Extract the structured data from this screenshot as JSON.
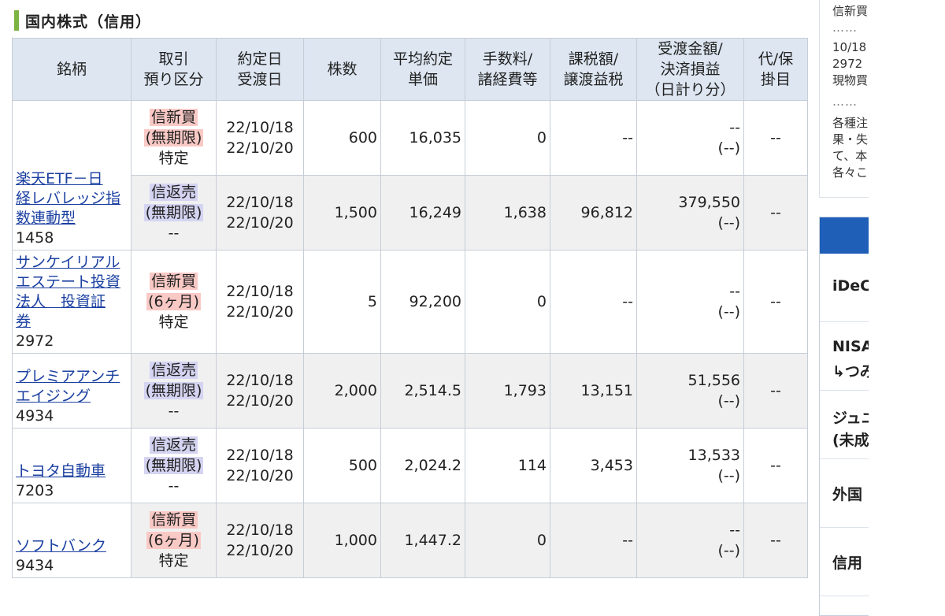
{
  "section_title": "国内株式（信用）",
  "columns": [
    [
      "銘柄"
    ],
    [
      "取引",
      "預り区分"
    ],
    [
      "約定日",
      "受渡日"
    ],
    [
      "株数"
    ],
    [
      "平均約定",
      "単価"
    ],
    [
      "手数料/",
      "諸経費等"
    ],
    [
      "課税額/",
      "譲渡益税"
    ],
    [
      "受渡金額/",
      "決済損益",
      "（日計り分）"
    ],
    [
      "代/保",
      "掛目"
    ]
  ],
  "rows": [
    {
      "name_lines": [
        "楽天ETF－日",
        "経レバレッジ指",
        "数連動型"
      ],
      "code": "1458",
      "trades": [
        {
          "type": "信新買",
          "type_kind": "buy",
          "period": "(無期限)",
          "custody": "特定",
          "date1": "22/10/18",
          "date2": "22/10/20",
          "shares": "600",
          "price": "16,035",
          "fee": "0",
          "tax": "--",
          "amount": "--",
          "pl": "(--)",
          "margin": "--"
        },
        {
          "type": "信返売",
          "type_kind": "sell",
          "period": "(無期限)",
          "custody": "--",
          "date1": "22/10/18",
          "date2": "22/10/20",
          "shares": "1,500",
          "price": "16,249",
          "fee": "1,638",
          "tax": "96,812",
          "amount": "379,550",
          "pl": "(--)",
          "margin": "--"
        }
      ]
    },
    {
      "name_lines": [
        "サンケイリアル",
        "エステート投資",
        "法人　投資証",
        "券"
      ],
      "code": "2972",
      "trades": [
        {
          "type": "信新買",
          "type_kind": "buy",
          "period": "(6ヶ月)",
          "custody": "特定",
          "date1": "22/10/18",
          "date2": "22/10/20",
          "shares": "5",
          "price": "92,200",
          "fee": "0",
          "tax": "--",
          "amount": "--",
          "pl": "(--)",
          "margin": "--"
        }
      ]
    },
    {
      "name_lines": [
        "プレミアアンチ",
        "エイジング"
      ],
      "code": "4934",
      "trades": [
        {
          "type": "信返売",
          "type_kind": "sell",
          "period": "(無期限)",
          "custody": "--",
          "date1": "22/10/18",
          "date2": "22/10/20",
          "shares": "2,000",
          "price": "2,514.5",
          "fee": "1,793",
          "tax": "13,151",
          "amount": "51,556",
          "pl": "(--)",
          "margin": "--"
        }
      ]
    },
    {
      "name_lines": [
        "トヨタ自動車"
      ],
      "code": "7203",
      "trades": [
        {
          "type": "信返売",
          "type_kind": "sell",
          "period": "(無期限)",
          "custody": "--",
          "date1": "22/10/18",
          "date2": "22/10/20",
          "shares": "500",
          "price": "2,024.2",
          "fee": "114",
          "tax": "3,453",
          "amount": "13,533",
          "pl": "(--)",
          "margin": "--"
        }
      ]
    },
    {
      "name_lines": [
        "ソフトバンク"
      ],
      "code": "9434",
      "trades": [
        {
          "type": "信新買",
          "type_kind": "buy",
          "period": "(6ヶ月)",
          "custody": "特定",
          "date1": "22/10/18",
          "date2": "22/10/20",
          "shares": "1,000",
          "price": "1,447.2",
          "fee": "0",
          "tax": "--",
          "amount": "--",
          "pl": "(--)",
          "margin": "--"
        }
      ]
    }
  ],
  "right_panel": {
    "lines": [
      "信新買",
      "……",
      "10/18",
      "2972",
      "現物買",
      "……",
      "各種注",
      "果・失",
      "て、本",
      "各々こ"
    ]
  },
  "side_menu": {
    "items": [
      {
        "label": "iDeCo"
      },
      {
        "label": "NISA",
        "sub": "つみ"
      },
      {
        "label": "ジュニ",
        "sub": "(未成"
      },
      {
        "label": "外国"
      },
      {
        "label": "信用"
      }
    ]
  },
  "colors": {
    "buy_label": "#f9c9c5",
    "sell_label": "#d4d4f2",
    "header_bg": "#dde6f1",
    "accent_bar": "#7cb342",
    "menu_head": "#1f5fb8"
  }
}
